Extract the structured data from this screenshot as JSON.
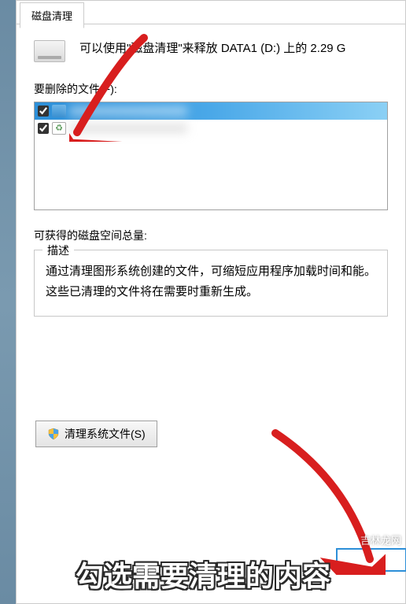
{
  "tab": {
    "title": "磁盘清理"
  },
  "intro": {
    "text": "可以使用\"磁盘清理\"来释放 DATA1 (D:) 上的 2.29 G"
  },
  "files": {
    "label": "要删除的文件(F):",
    "items": [
      {
        "checked": true,
        "selected": true,
        "icon": "folder"
      },
      {
        "checked": true,
        "selected": false,
        "icon": "recycle"
      }
    ]
  },
  "space": {
    "label": "可获得的磁盘空间总量:"
  },
  "desc": {
    "legend": "描述",
    "text": "通过清理图形系统创建的文件，可缩短应用程序加载时间和能。这些已清理的文件将在需要时重新生成。"
  },
  "sysbtn": {
    "label": "清理系统文件(S)"
  },
  "caption": "勾选需要清理的内容",
  "watermark": "吉林龙网"
}
